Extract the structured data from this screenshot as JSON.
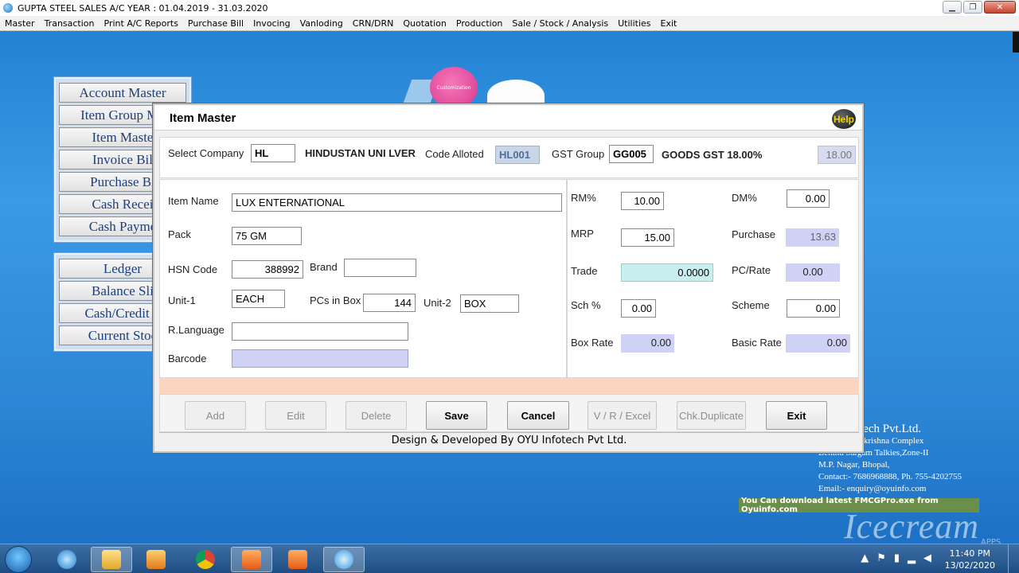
{
  "window": {
    "title": "GUPTA STEEL SALES A/C YEAR : 01.04.2019 - 31.03.2020"
  },
  "menu": [
    "Master",
    "Transaction",
    "Print A/C Reports",
    "Purchase Bill",
    "Invocing",
    "Vanloding",
    "CRN/DRN",
    "Quotation",
    "Production",
    "Sale / Stock / Analysis",
    "Utilities",
    "Exit"
  ],
  "side_menu_1": [
    "Account Master",
    "Item Group Ma",
    "Item Maste",
    "Invoice Bil",
    "Purchase Bi",
    "Cash Recei",
    "Cash Payme"
  ],
  "side_menu_2": [
    "Ledger",
    "Balance Sli",
    "Cash/Credit S",
    "Current Stoc"
  ],
  "bubble_label": "Customization",
  "company_info": {
    "name": "tech Pvt.Ltd.",
    "line1": "akrishna Complex",
    "line2": "Behind Sargam Talkies,Zone-II",
    "line3": "M.P. Nagar, Bhopal,",
    "line4": "Contact:- 7686968888, Ph. 755-4202755",
    "line5": "Email:- enquiry@oyuinfo.com",
    "download": "You Can download latest FMCGPro.exe from Oyuinfo.com"
  },
  "watermark": {
    "text": "Icecream",
    "sub": "APPS"
  },
  "dialog": {
    "title": "Item Master",
    "help": "Help",
    "top": {
      "company_label": "Select Company",
      "company_code": "HL",
      "company_name": "HINDUSTAN UNI LVER",
      "code_label": "Code Alloted",
      "code_value": "HL001",
      "gst_label": "GST Group",
      "gst_code": "GG005",
      "gst_name": "GOODS GST 18.00%",
      "gst_rate": "18.00"
    },
    "left": {
      "item_name_label": "Item Name",
      "item_name": "LUX ENTERNATIONAL",
      "pack_label": "Pack",
      "pack": "75 GM",
      "hsn_label": "HSN Code",
      "hsn": "388992",
      "brand_label": "Brand",
      "brand": "",
      "unit1_label": "Unit-1",
      "unit1": "EACH",
      "pcs_label": "PCs in Box",
      "pcs": "144",
      "unit2_label": "Unit-2",
      "unit2": "BOX",
      "rlang_label": "R.Language",
      "rlang": "",
      "barcode_label": "Barcode",
      "barcode": ""
    },
    "right": {
      "rm_label": "RM%",
      "rm": "10.00",
      "dm_label": "DM%",
      "dm": "0.00",
      "mrp_label": "MRP",
      "mrp": "15.00",
      "purchase_label": "Purchase",
      "purchase": "13.63",
      "trade_label": "Trade",
      "trade": "0.0000",
      "pcrate_label": "PC/Rate",
      "pcrate": "0.00",
      "sch_label": "Sch %",
      "sch": "0.00",
      "scheme_label": "Scheme",
      "scheme": "0.00",
      "boxrate_label": "Box Rate",
      "boxrate": "0.00",
      "basicrate_label": "Basic Rate",
      "basicrate": "0.00"
    },
    "buttons": {
      "add": "Add",
      "edit": "Edit",
      "delete": "Delete",
      "save": "Save",
      "cancel": "Cancel",
      "vr": "V / R / Excel",
      "chk": "Chk.Duplicate",
      "exit": "Exit"
    },
    "footer": "Design & Developed By OYU Infotech Pvt Ltd."
  },
  "taskbar": {
    "time": "11:40 PM",
    "date": "13/02/2020"
  }
}
